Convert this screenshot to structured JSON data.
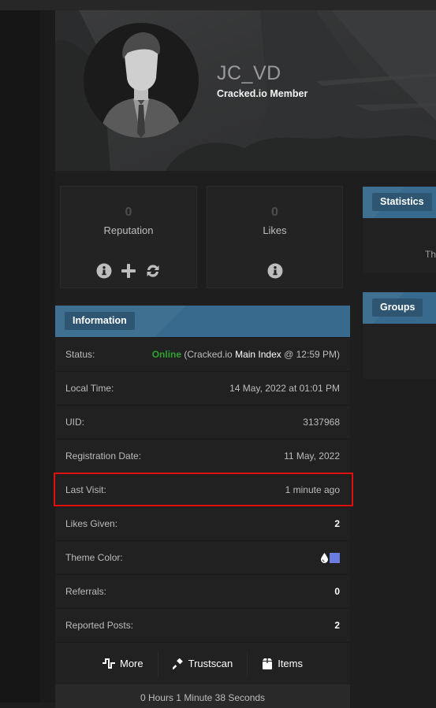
{
  "profile": {
    "username": "JC_VD",
    "usertitle": "Cracked.io Member",
    "avatar_icon": "businessman-avatar"
  },
  "stats": [
    {
      "value": "0",
      "label": "Reputation",
      "icons": [
        "info-icon",
        "plus-icon",
        "refresh-icon"
      ]
    },
    {
      "value": "0",
      "label": "Likes",
      "icons": [
        "info-icon"
      ]
    }
  ],
  "information": {
    "title": "Information",
    "status": {
      "label": "Status:",
      "state": "Online",
      "location_prefix": " (Cracked.io ",
      "location": "Main Index",
      "time": " @ 12:59 PM)"
    },
    "rows": [
      {
        "label": "Local Time:",
        "value": "14 May, 2022 at 01:01 PM"
      },
      {
        "label": "UID:",
        "value": "3137968"
      },
      {
        "label": "Registration Date:",
        "value": "11 May, 2022"
      },
      {
        "label": "Last Visit:",
        "value": "1 minute ago"
      },
      {
        "label": "Likes Given:",
        "value": "2"
      }
    ],
    "theme": {
      "label": "Theme Color:",
      "color": "#6c7de0",
      "icon": "droplet-icon"
    },
    "rows2": [
      {
        "label": "Referrals:",
        "value": "0"
      },
      {
        "label": "Reported Posts:",
        "value": "2"
      }
    ],
    "actions": [
      {
        "label": "More",
        "icon": "pulse-icon"
      },
      {
        "label": "Trustscan",
        "icon": "gavel-icon"
      },
      {
        "label": "Items",
        "icon": "box-icon"
      }
    ],
    "footer_text": "0 Hours 1 Minute 38 Seconds"
  },
  "side_panels": [
    {
      "title": "Statistics",
      "partial_text": "Th"
    },
    {
      "title": "Groups"
    }
  ],
  "colors": {
    "accent": "#3f7092",
    "online": "#2ea12e",
    "highlight": "#e01010"
  }
}
